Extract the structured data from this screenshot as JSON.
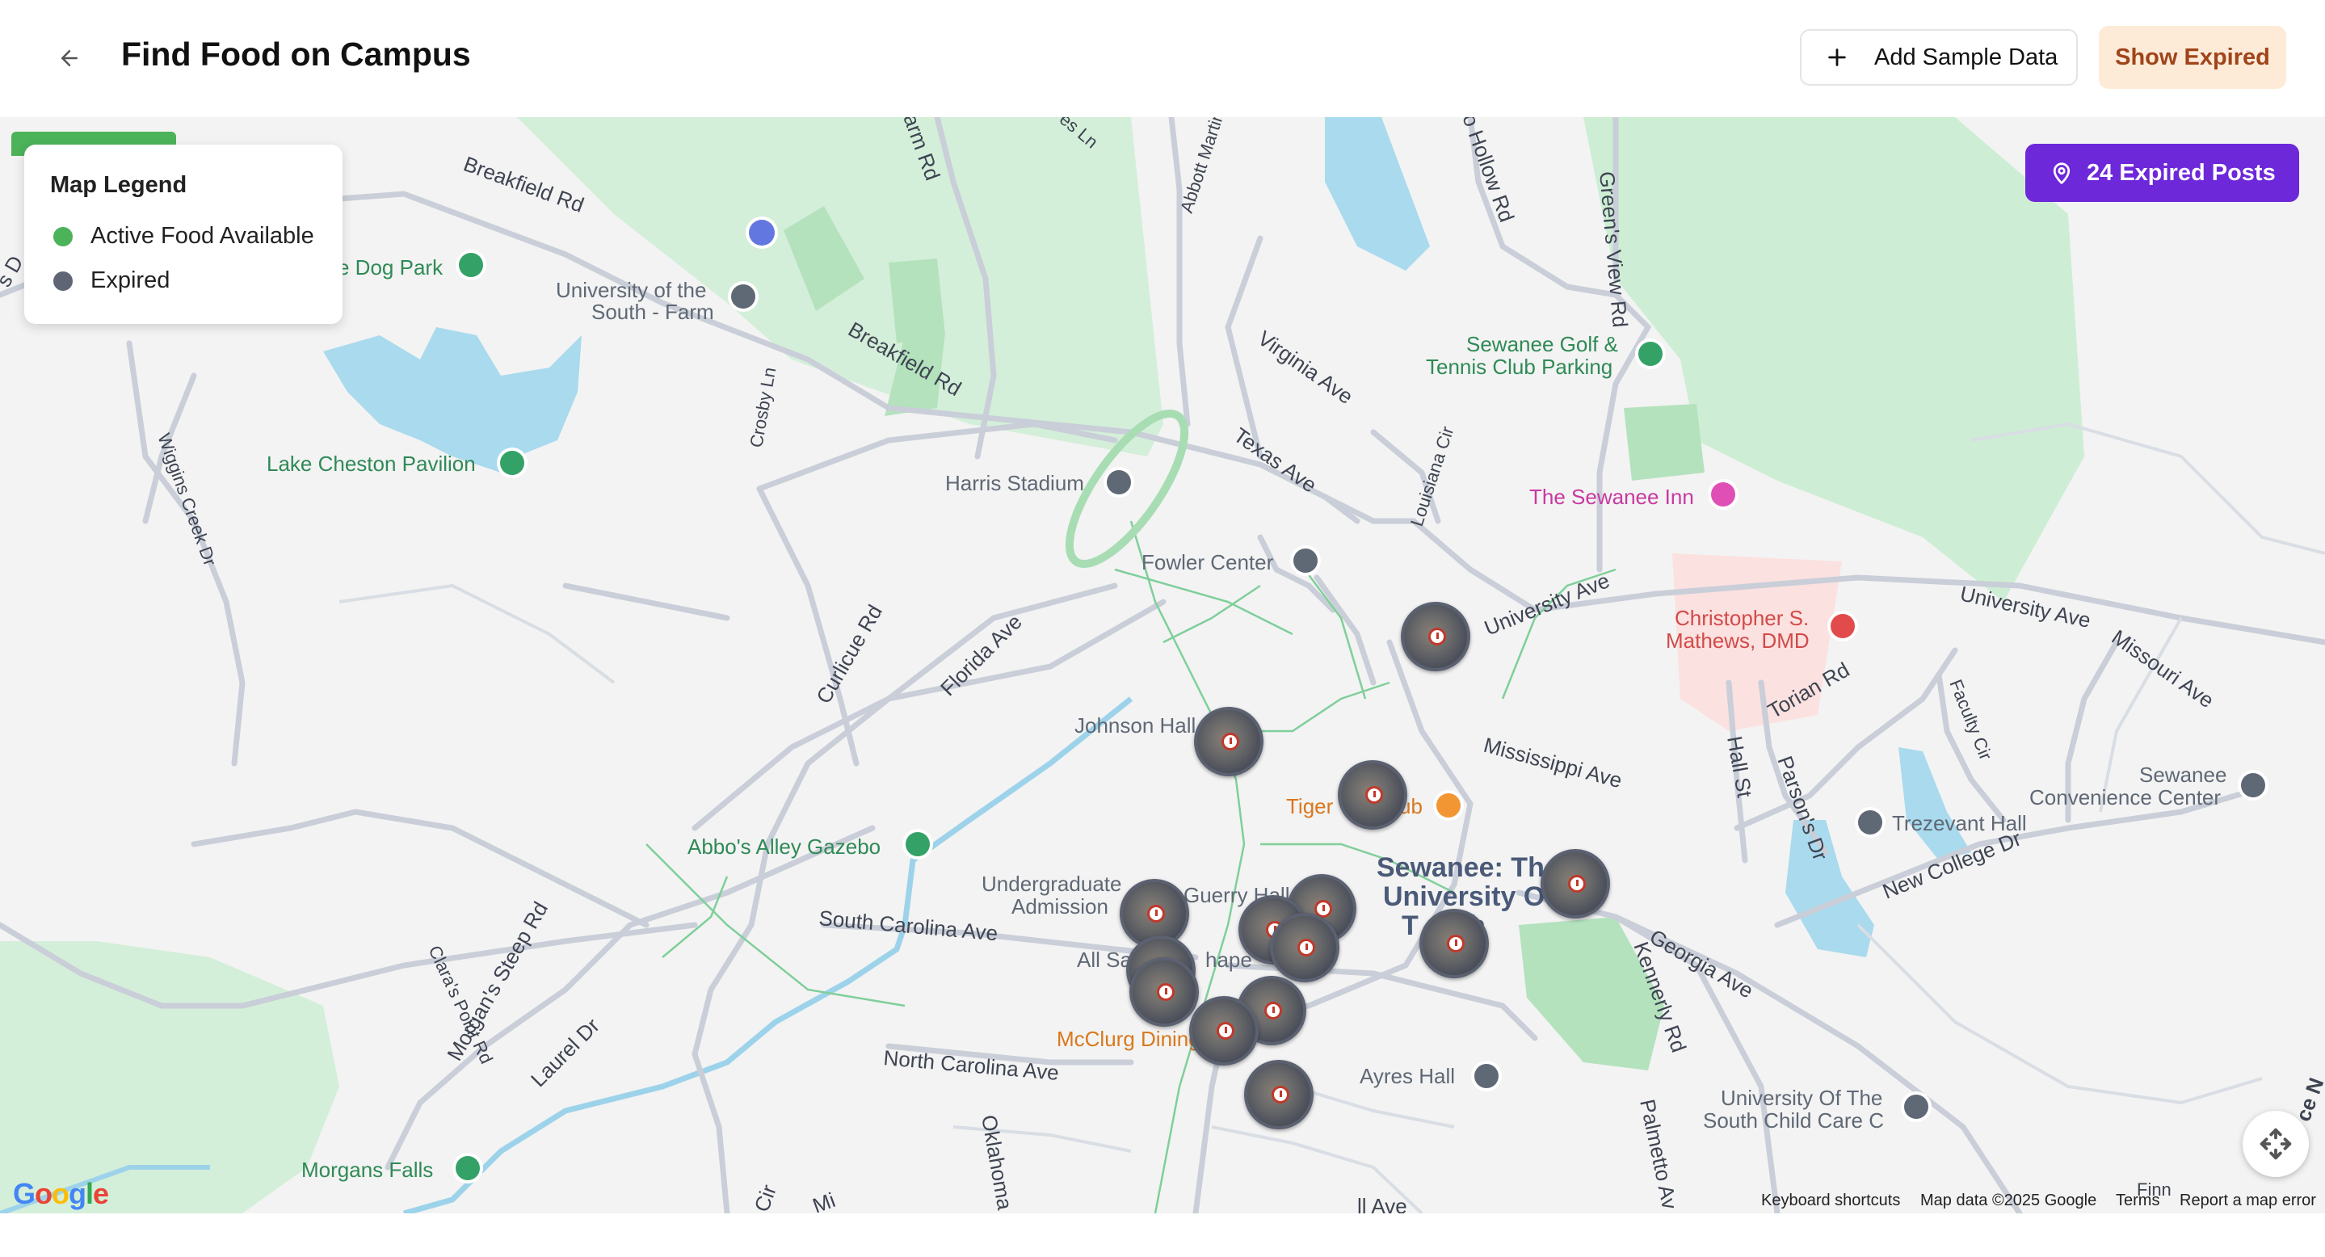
{
  "header": {
    "title": "Find Food on Campus",
    "add_sample_label": "Add Sample Data",
    "show_expired_label": "Show Expired"
  },
  "legend": {
    "title": "Map Legend",
    "items": [
      {
        "label": "Active Food Available",
        "color": "#4cb35a"
      },
      {
        "label": "Expired",
        "color": "#5f6575"
      }
    ]
  },
  "expired_badge": {
    "label": "24 Expired Posts"
  },
  "map": {
    "labels": {
      "breakfield_rd_1": "Breakfield Rd",
      "breakfield_rd_2": "Breakfield Rd",
      "dog_park": "e Dog Park",
      "uni_farm": "University of the",
      "uni_farm_2": "South - Farm",
      "crosby_ln": "Crosby Ln",
      "lake_cheston": "Lake Cheston Pavilion",
      "wiggins": "Wiggins Creek Dr",
      "harris": "Harris Stadium",
      "fowler": "Fowler Center",
      "virginia": "Virginia Ave",
      "texas": "Texas Ave",
      "louisiana": "Louisiana Cir",
      "abbott": "Abbott Martin R",
      "hollow": "o Hollow Rd",
      "greens_view": "Green's View Rd",
      "golf": "Sewanee Golf &",
      "golf_2": "Tennis Club Parking",
      "sewanee_inn": "The Sewanee Inn",
      "christopher": "Christopher S.",
      "christopher_2": "Mathews, DMD",
      "university_ave_1": "University Ave",
      "university_ave_2": "University Ave",
      "missouri": "Missouri Ave",
      "torian": "Torian Rd",
      "faculty": "Faculty Cir",
      "conv_center": "Sewanee",
      "conv_center_2": "Convenience Center",
      "trezevant": "Trezevant Hall",
      "new_college": "New College Dr",
      "hall_st": "Hall St",
      "parsons": "Parson's Dr",
      "curlicue": "Curlicue Rd",
      "florida": "Florida Ave",
      "johnson": "Johnson Hall",
      "mississippi": "Mississippi Ave",
      "tiger": "Tiger",
      "tiger_2": "ub",
      "abbos": "Abbo's Alley Gazebo",
      "sewanee_uni": "Sewanee: Th",
      "sewanee_uni_2": "University O",
      "sewanee_uni_3": "T  outh",
      "undergrad": "Undergraduate",
      "undergrad_2": "Admission",
      "guerry": "Guerry Hall",
      "all_saints": "All Sa",
      "all_saints_2": "hape",
      "south_carolina": "South Carolina Ave",
      "clara": "Clara's Point Rd",
      "morgans_steep": "Morgan's Steep Rd",
      "laurel": "Laurel Dr",
      "mcclurg": "McClurg Dining",
      "north_carolina": "North Carolina Ave",
      "oklahoma": "Oklahoma",
      "ayres": "Ayres Hall",
      "georgia": "Georgia Ave",
      "kennerly": "Kennerly Rd",
      "palmetto": "Palmetto Av",
      "child_care": "University Of The",
      "child_care_2": "South Child Care C",
      "morgans_falls": "Morgans Falls",
      "farm_rd": "arm Rd",
      "es_ln": "es Ln",
      "s_d": "s D",
      "ave_bottom": "ll Ave",
      "finn": "Finn",
      "ce_n": "ce N",
      "cir": "Cir",
      "mi": "Mi"
    },
    "footer": {
      "keyboard": "Keyboard shortcuts",
      "data": "Map data ©2025 Google",
      "terms": "Terms",
      "report": "Report a map error"
    },
    "logo": "Google"
  }
}
